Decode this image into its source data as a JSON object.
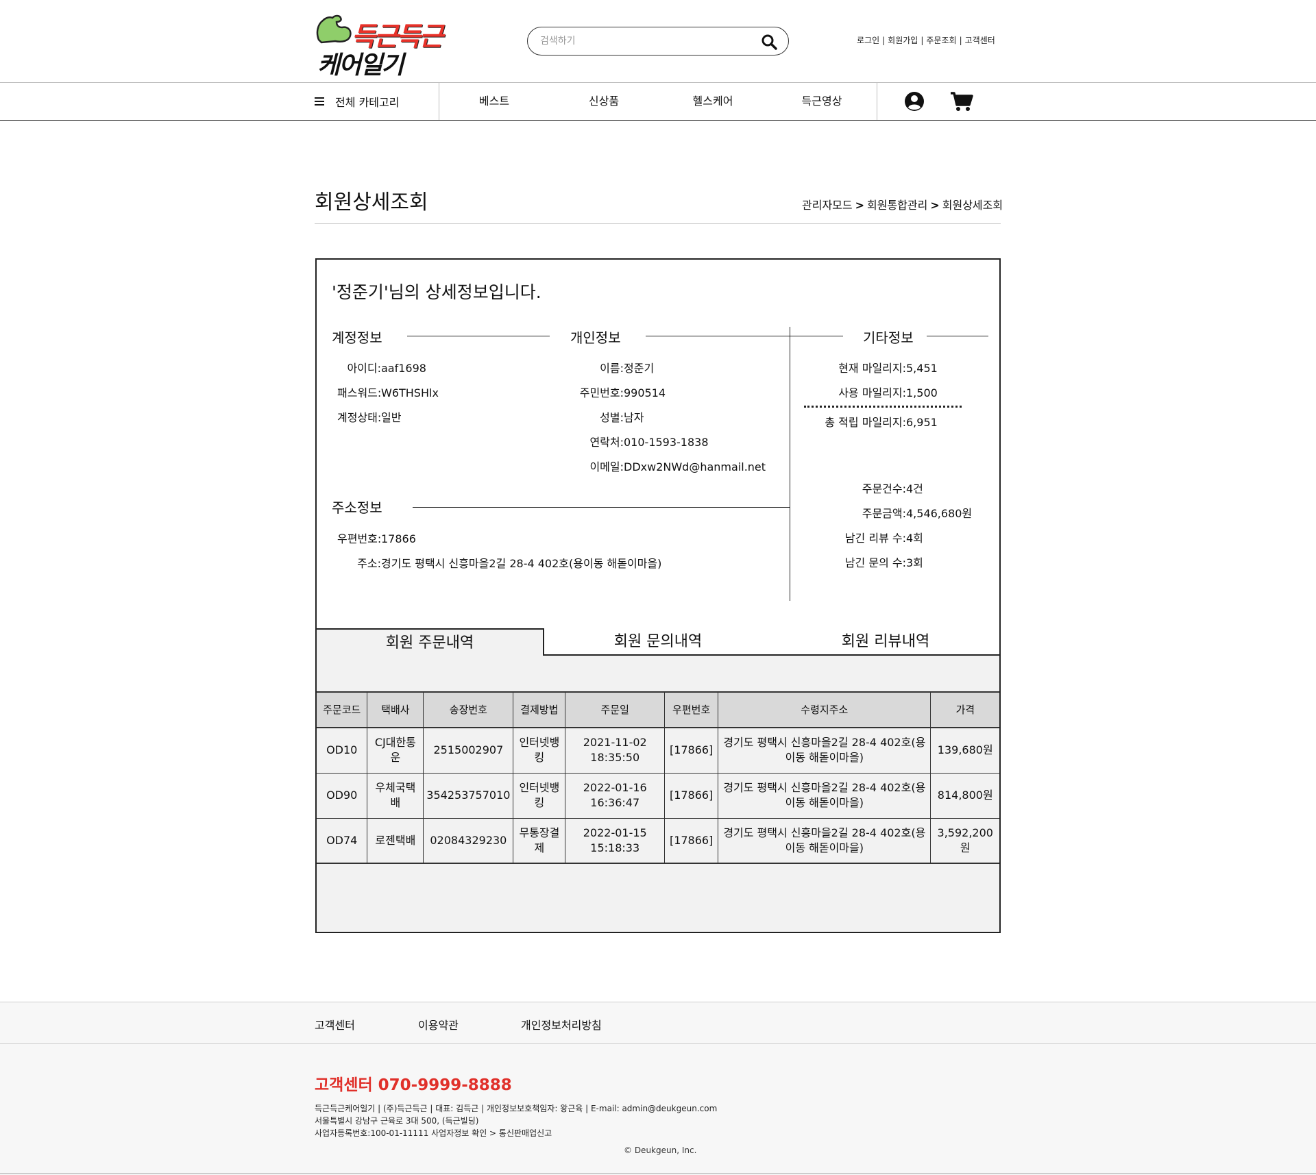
{
  "logo": {
    "line1": "득근득근",
    "line2": "케어일기"
  },
  "search": {
    "placeholder": "검색하기"
  },
  "top_links": [
    "로그인",
    "회원가입",
    "주문조회",
    "고객센터"
  ],
  "nav": {
    "category": "전체 카테고리",
    "items": [
      "베스트",
      "신상품",
      "헬스케어",
      "득근영상"
    ]
  },
  "page": {
    "title": "회원상세조회",
    "breadcrumb": [
      "관리자모드",
      "회원통합관리",
      "회원상세조회"
    ]
  },
  "detail": {
    "heading": "'정준기'님의 상세정보입니다.",
    "account": {
      "title": "계정정보",
      "rows": [
        {
          "label": "아이디: ",
          "value": "aaf1698"
        },
        {
          "label": "패스워드: ",
          "value": "W6THSHlx"
        },
        {
          "label": "계정상태: ",
          "value": "일반"
        }
      ]
    },
    "personal": {
      "title": "개인정보",
      "rows": [
        {
          "label": "이름: ",
          "value": "정준기"
        },
        {
          "label": "주민번호: ",
          "value": "990514"
        },
        {
          "label": "성별: ",
          "value": "남자"
        },
        {
          "label": "연락처: ",
          "value": "010-1593-1838"
        },
        {
          "label": "이메일: ",
          "value": "DDxw2NWd@hanmail.net"
        }
      ]
    },
    "address": {
      "title": "주소정보",
      "rows": [
        {
          "label": "우편번호: ",
          "value": "17866"
        },
        {
          "label": "주소: ",
          "value": "경기도 평택시 신흥마을2길 28-4 402호(용이동 해돋이마을)"
        }
      ]
    },
    "etc": {
      "title": "기타정보",
      "mileage": [
        {
          "label": "현재 마일리지: ",
          "value": "5,451"
        },
        {
          "label": "사용 마일리지: ",
          "value": "1,500"
        },
        {
          "label": "총 적립 마일리지: ",
          "value": "6,951"
        }
      ],
      "stats": [
        {
          "label": "주문건수: ",
          "value": "4건"
        },
        {
          "label": "주문금액: ",
          "value": "4,546,680원"
        },
        {
          "label": "남긴 리뷰 수: ",
          "value": "4회"
        },
        {
          "label": "남긴 문의 수: ",
          "value": "3회"
        }
      ]
    }
  },
  "tabs": [
    "회원 주문내역",
    "회원 문의내역",
    "회원 리뷰내역"
  ],
  "orders": {
    "headers": [
      "주문코드",
      "택배사",
      "송장번호",
      "결제방법",
      "주문일",
      "우편번호",
      "수령지주소",
      "가격"
    ],
    "rows": [
      [
        "OD10",
        "CJ대한통운",
        "2515002907",
        "인터넷뱅킹",
        "2021-11-02 18:35:50",
        "[17866]",
        "경기도 평택시 신흥마을2길 28-4 402호(용이동 해돋이마을)",
        "139,680원"
      ],
      [
        "OD90",
        "우체국택배",
        "354253757010",
        "인터넷뱅킹",
        "2022-01-16 16:36:47",
        "[17866]",
        "경기도 평택시 신흥마을2길 28-4 402호(용이동 해돋이마을)",
        "814,800원"
      ],
      [
        "OD74",
        "로젠택배",
        "02084329230",
        "무통장결제",
        "2022-01-15 15:18:33",
        "[17866]",
        "경기도 평택시 신흥마을2길 28-4 402호(용이동 해돋이마을)",
        "3,592,200원"
      ]
    ]
  },
  "footer": {
    "links": [
      "고객센터",
      "이용약관",
      "개인정보처리방침"
    ],
    "cs_phone": "고객센터 070-9999-8888",
    "line1": "득근득근케어일기 | (주)득근득근 | 대표: 김득근 | 개인정보보호책임자: 왕근육 | E-mail: admin@deukgeun.com",
    "line2": "서울특별시 강남구 근육로 3대 500, (득근빌딩)",
    "line3": "사업자등록번호:100-01-11111 사업자정보 확인 > 통신판매업신고",
    "copyright": "© Deukgeun, Inc."
  },
  "colors": {
    "accent": "#e8322a",
    "table_header": "#d9d9d9",
    "panel": "#f2f2f2"
  },
  "icons": {
    "search": "search-icon",
    "menu": "hamburger-icon",
    "user": "user-icon",
    "cart": "cart-icon"
  }
}
